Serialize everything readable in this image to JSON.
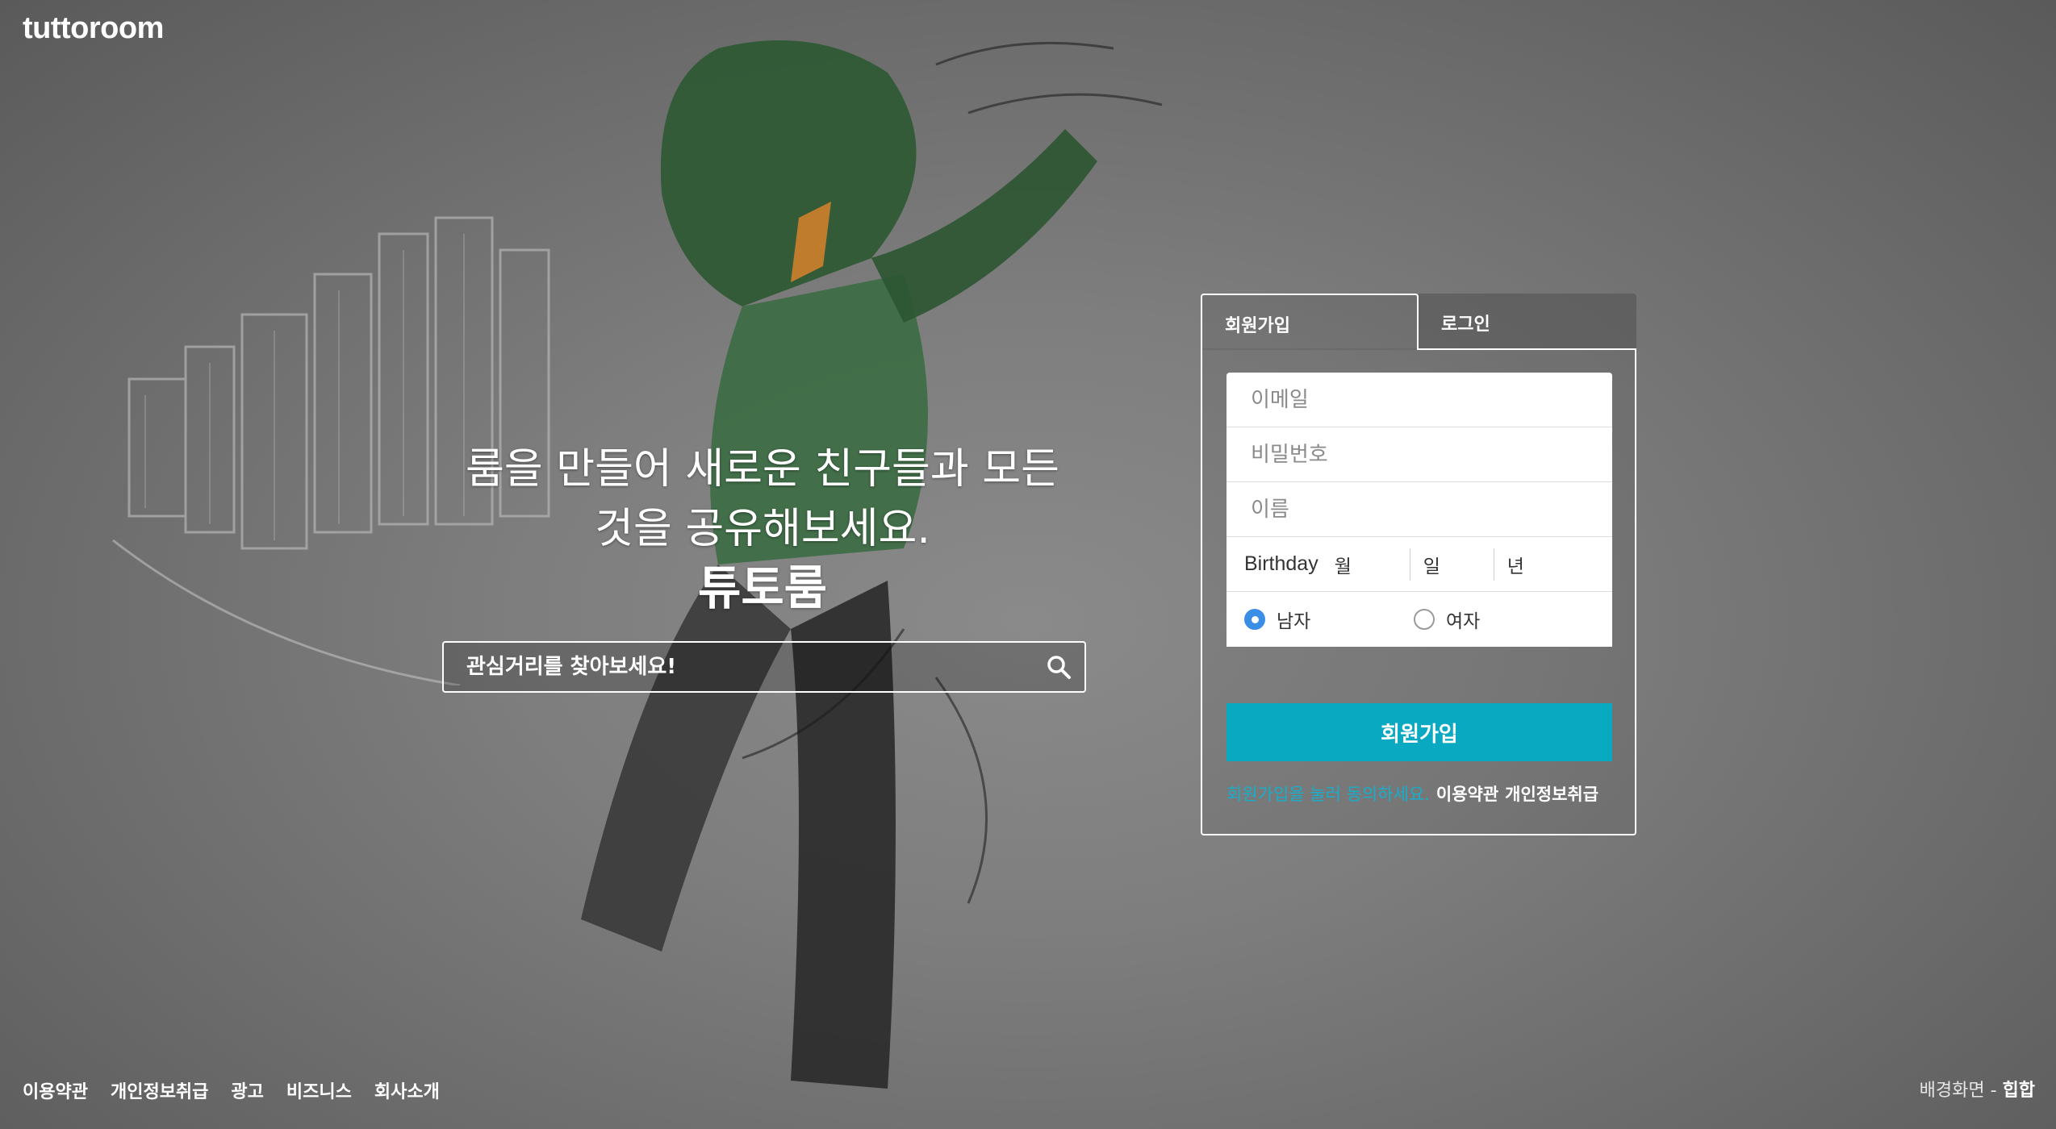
{
  "brand": {
    "logo": "tuttoroom"
  },
  "hero": {
    "headline_line1": "룸을 만들어 새로운 친구들과 모든",
    "headline_line2": "것을 공유해보세요.",
    "brand_name": "튜토룸"
  },
  "search": {
    "placeholder": "관심거리를 찾아보세요!"
  },
  "auth": {
    "tabs": [
      {
        "label": "회원가입",
        "active": true
      },
      {
        "label": "로그인",
        "active": false
      }
    ],
    "fields": {
      "email_placeholder": "이메일",
      "password_placeholder": "비밀번호",
      "name_placeholder": "이름"
    },
    "birthday": {
      "label": "Birthday",
      "month": "월",
      "day": "일",
      "year": "년"
    },
    "gender": {
      "male": "남자",
      "female": "여자",
      "selected": "남자"
    },
    "submit_label": "회원가입",
    "terms": {
      "note": "회원가입을 눌러 동의하세요.",
      "terms_link": "이용약관",
      "privacy_link": "개인정보취급"
    }
  },
  "footer": {
    "links": [
      "이용약관",
      "개인정보취급",
      "광고",
      "비즈니스",
      "회사소개"
    ]
  },
  "background_credit": {
    "label": "배경화면 -",
    "value": "힙합"
  },
  "colors": {
    "accent": "#0aa9c2",
    "terms_note": "#18aecb",
    "radio_checked": "#3b8ee6"
  }
}
